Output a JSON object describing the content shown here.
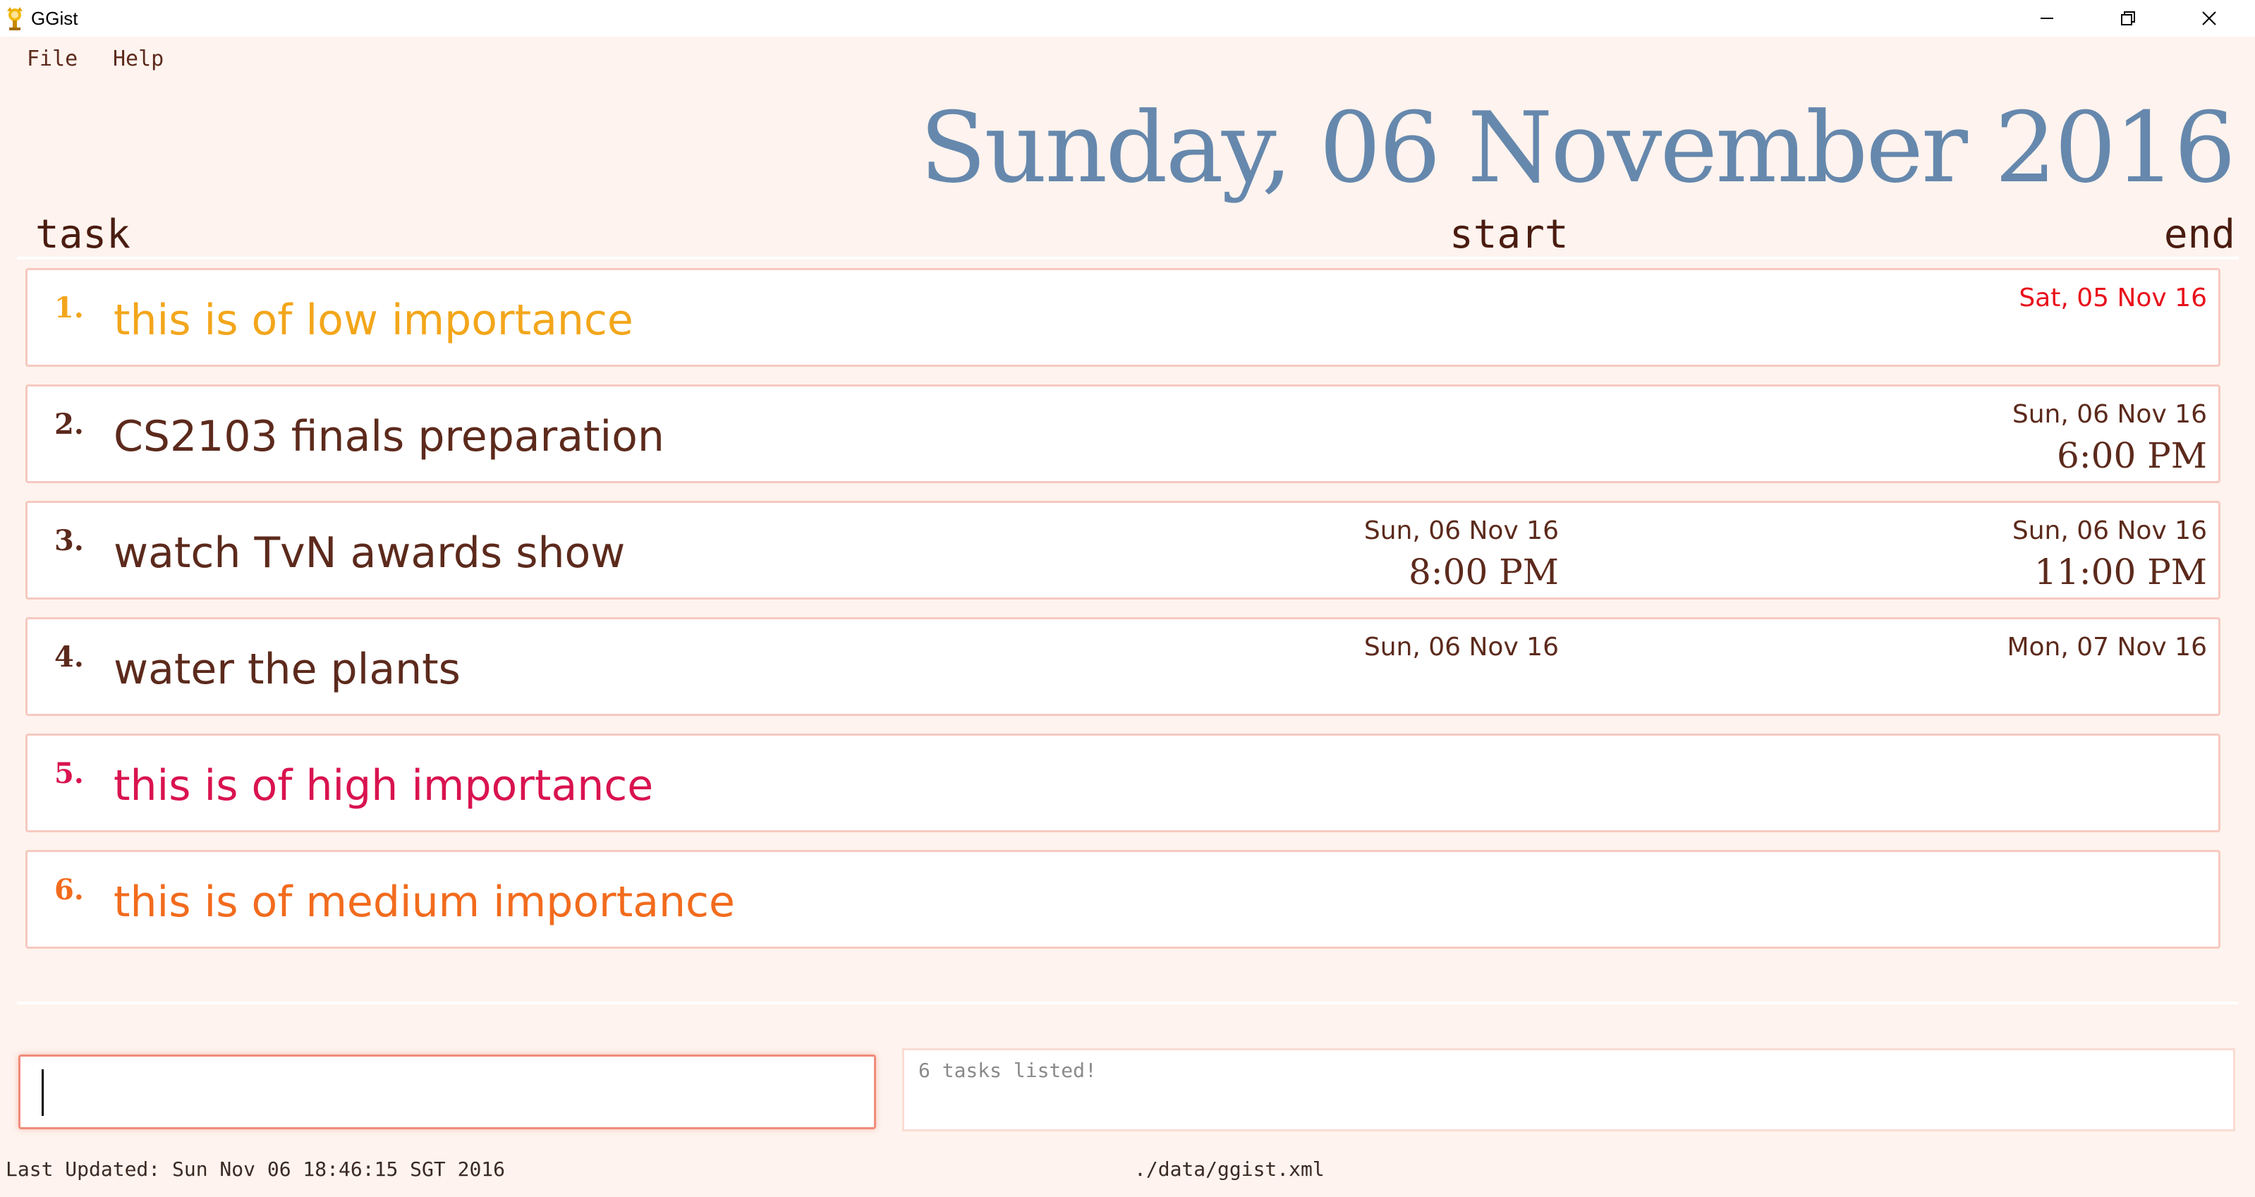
{
  "window": {
    "title": "GGist",
    "icon": "ggist-app-icon"
  },
  "menu": {
    "items": [
      {
        "label": "File"
      },
      {
        "label": "Help"
      }
    ]
  },
  "header": {
    "date": "Sunday, 06 November 2016"
  },
  "columns": {
    "task": "task",
    "start": "start",
    "end": "end"
  },
  "colors": {
    "low": "#f3a61b",
    "medium": "#f26b1d",
    "high": "#d9134f",
    "normal": "#5c2a1c",
    "overdue": "#e8101b",
    "date_header": "#6688ad"
  },
  "tasks": [
    {
      "index": "1.",
      "name": "this is of low importance",
      "priority": "low",
      "start_date": "",
      "start_time": "",
      "end_date": "Sat, 05 Nov 16",
      "end_time": "",
      "end_overdue": true
    },
    {
      "index": "2.",
      "name": "CS2103 finals preparation",
      "priority": "normal",
      "start_date": "",
      "start_time": "",
      "end_date": "Sun, 06 Nov 16",
      "end_time": "6:00 PM",
      "end_overdue": false
    },
    {
      "index": "3.",
      "name": "watch TvN awards show",
      "priority": "normal",
      "start_date": "Sun, 06 Nov 16",
      "start_time": "8:00 PM",
      "end_date": "Sun, 06 Nov 16",
      "end_time": "11:00 PM",
      "end_overdue": false
    },
    {
      "index": "4.",
      "name": "water the plants",
      "priority": "normal",
      "start_date": "Sun, 06 Nov 16",
      "start_time": "",
      "end_date": "Mon, 07 Nov 16",
      "end_time": "",
      "end_overdue": false
    },
    {
      "index": "5.",
      "name": "this is of high importance",
      "priority": "high",
      "start_date": "",
      "start_time": "",
      "end_date": "",
      "end_time": "",
      "end_overdue": false
    },
    {
      "index": "6.",
      "name": "this is of medium importance",
      "priority": "medium",
      "start_date": "",
      "start_time": "",
      "end_date": "",
      "end_time": "",
      "end_overdue": false
    }
  ],
  "command": {
    "value": ""
  },
  "result": {
    "text": "6 tasks listed!"
  },
  "status": {
    "last_updated": "Last Updated: Sun Nov 06 18:46:15 SGT 2016",
    "file_path": "./data/ggist.xml"
  }
}
